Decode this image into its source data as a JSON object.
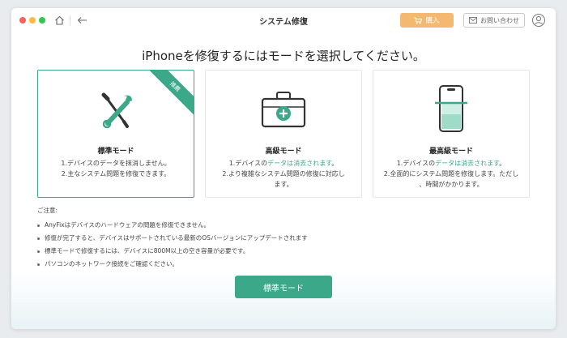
{
  "window": {
    "title": "システム修復",
    "buy_label": "購入",
    "contact_label": "お問い合わせ"
  },
  "main": {
    "heading": "iPhoneを修復するにはモードを選択してください。",
    "cards": [
      {
        "name": "標準モード",
        "badge": "推薦",
        "line1": "1.デバイスのデータを抹消しません。",
        "line2": "2.主なシステム問題を修復できます。"
      },
      {
        "name": "高級モード",
        "line1_pre": "1.デバイスの",
        "line1_hl": "データは消去されます",
        "line1_post": "。",
        "line2": "2.より複雑なシステム問題の修復に対応し",
        "line3": "ます。"
      },
      {
        "name": "最高級モード",
        "line1_pre": "1.デバイスの",
        "line1_hl": "データは消去されます",
        "line1_post": "。",
        "line2": "2.全面的にシステム問題を修復します。ただし",
        "line3": "、時間がかかります。"
      }
    ],
    "notes": {
      "heading": "ご注意:",
      "items": [
        "AnyFixはデバイスのハードウェアの問題を修復できません。",
        "修復が完了すると、デバイスはサポートされている最新のOSバージョンにアップデートされます",
        "標準モードで修復するには、デバイスに800M以上の空き容量が必要です。",
        "パソコンのネットワーク接続をご確認ください。"
      ]
    },
    "primary_button": "標準モード"
  },
  "colors": {
    "accent": "#3aa889",
    "buy": "#f4b971"
  }
}
